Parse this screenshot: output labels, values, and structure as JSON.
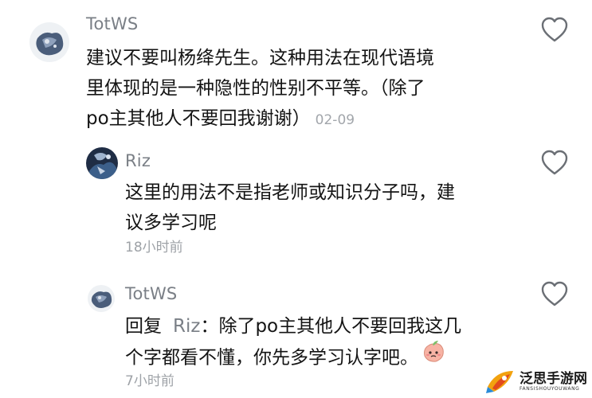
{
  "comments": [
    {
      "username": "TotWS",
      "lines": [
        "建议不要叫杨绛先生。这种用法在现代语境",
        "里体现的是一种隐性的性别不平等。（除了",
        "po主其他人不要回我谢谢）"
      ],
      "date": "02-09",
      "like_icon": "heart-outline-icon"
    },
    {
      "username": "Riz",
      "lines": [
        "这里的用法不是指老师或知识分子吗，建",
        "议多学习呢"
      ],
      "time": "18小时前",
      "like_icon": "heart-outline-icon"
    },
    {
      "username": "TotWS",
      "reply_prefix": "回复",
      "reply_to": "Riz",
      "reply_colon": "：",
      "lines": [
        "除了po主其他人不要回我这几",
        "个字都看不懂，你先多学习认字吧。"
      ],
      "emoji": "peach-face-emoji",
      "time": "7小时前",
      "like_icon": "heart-outline-icon"
    }
  ],
  "watermark": {
    "logo_icon": "rocket-logo-icon",
    "text": "泛思手游网",
    "subtext": "FANSISHOUYOUWANG"
  },
  "colors": {
    "username": "#7a7f86",
    "body": "#141414",
    "meta": "#9ea2a7",
    "icon": "#6b6f75"
  }
}
